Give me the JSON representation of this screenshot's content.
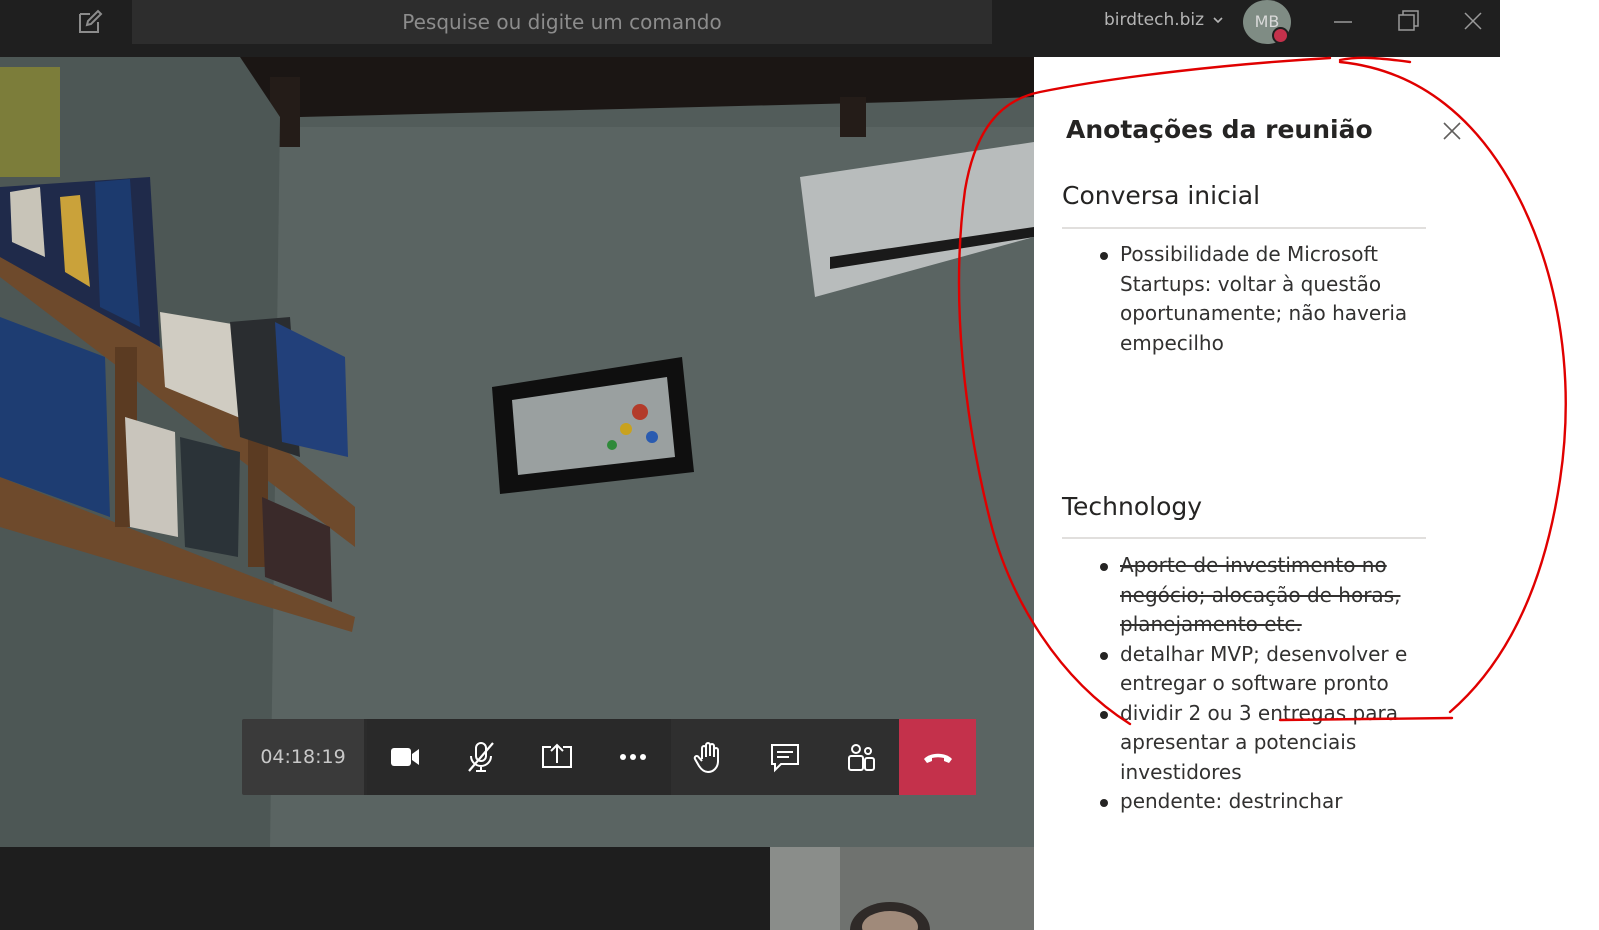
{
  "titlebar": {
    "search_placeholder": "Pesquise ou digite um comando",
    "org_name": "birdtech.biz",
    "avatar_initials": "MB"
  },
  "call": {
    "timer": "04:18:19"
  },
  "notes_panel": {
    "title": "Anotações da reunião",
    "sections": [
      {
        "title": "Conversa inicial",
        "items": [
          {
            "text": "Possibilidade de Microsoft Startups: voltar à questão oportunamente; não haveria empecilho",
            "struck": false
          }
        ]
      },
      {
        "title": "Technology",
        "items": [
          {
            "text": "Aporte de investimento no negócio; alocação de horas, planejamento etc.",
            "struck": true
          },
          {
            "text": "detalhar MVP; desenvolver e entregar o software pronto",
            "struck": false
          },
          {
            "text": "dividir 2 ou 3 entregas para apresentar a potenciais investidores",
            "struck": false
          },
          {
            "text": "pendente: destrinchar",
            "struck": false
          }
        ]
      }
    ]
  },
  "colors": {
    "hangup": "#c4314b",
    "annotation_ink": "#e00000",
    "titlebar": "#1f1f1f"
  },
  "icons": [
    "compose-icon",
    "chevron-down-icon",
    "minimize-icon",
    "maximize-icon",
    "close-icon",
    "camera-icon",
    "mic-off-icon",
    "share-screen-icon",
    "more-icon",
    "raise-hand-icon",
    "chat-icon",
    "participants-icon",
    "hangup-icon"
  ]
}
